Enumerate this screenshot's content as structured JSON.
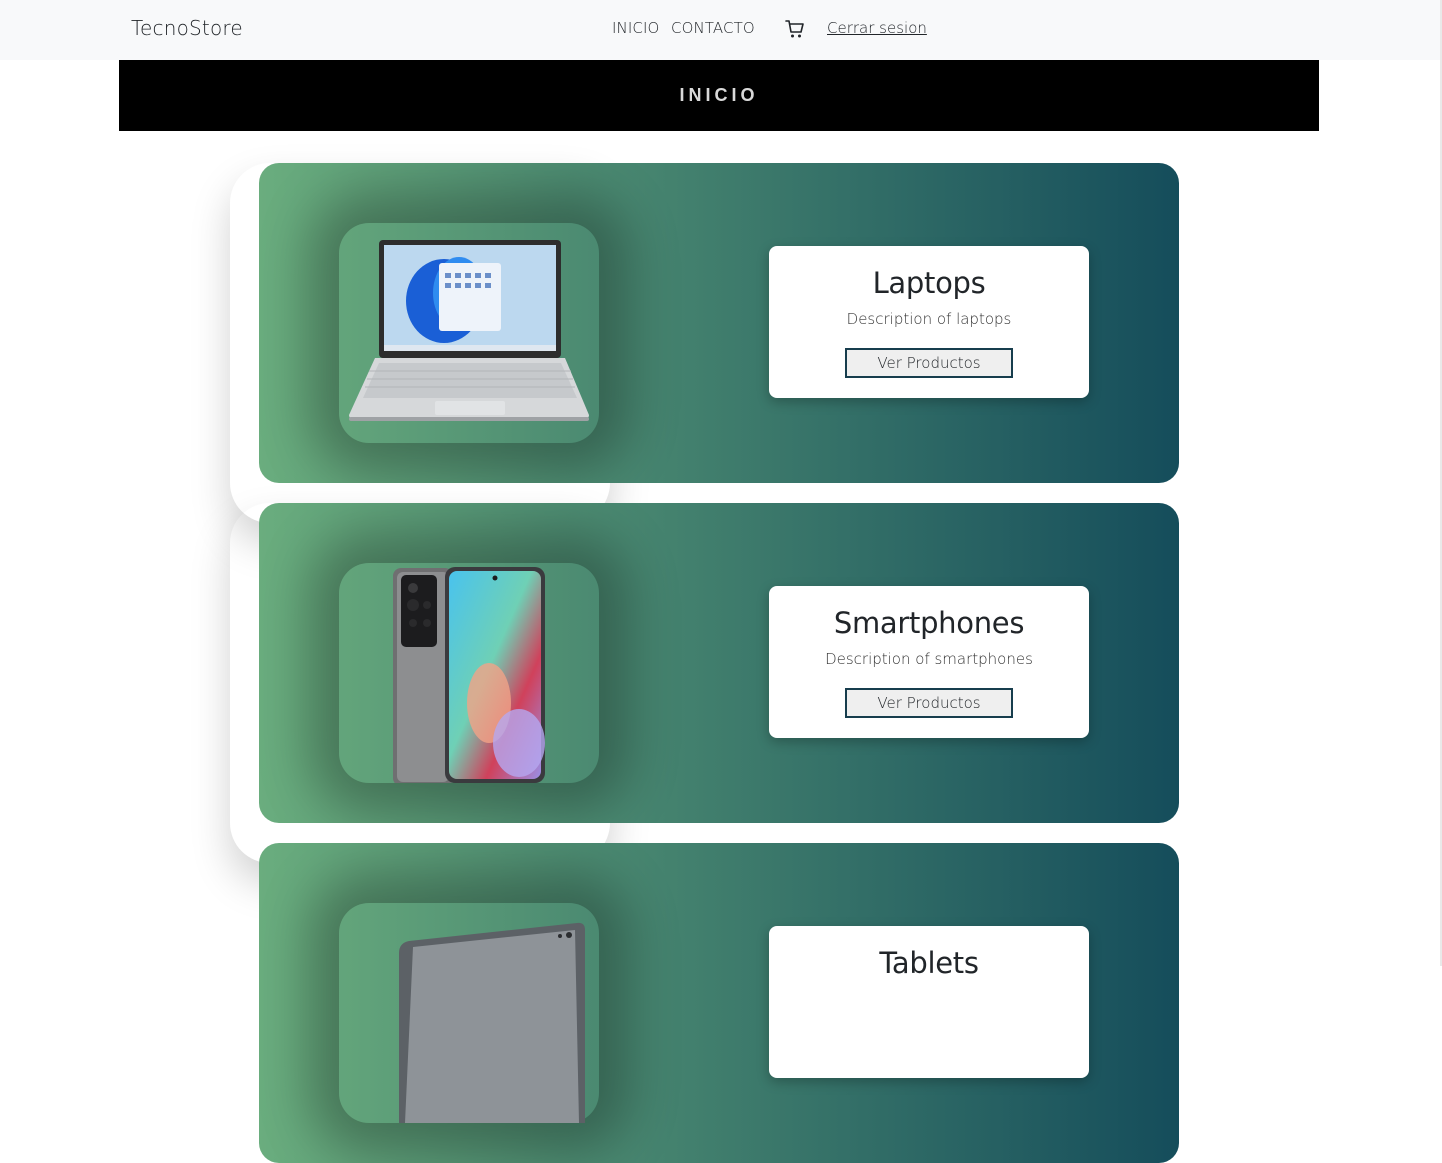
{
  "navbar": {
    "brand": "TecnoStore",
    "links": [
      "INICIO",
      "CONTACTO"
    ],
    "cart_icon": "cart-icon",
    "logout_label": "Cerrar sesion"
  },
  "banner": {
    "title": "INICIO"
  },
  "colors": {
    "gradient_start": "#6aad7e",
    "gradient_end": "#154d5b",
    "button_border": "#173d4d"
  },
  "categories": [
    {
      "title": "Laptops",
      "description": "Description of laptops",
      "button": "Ver Productos",
      "image": "laptop-image"
    },
    {
      "title": "Smartphones",
      "description": "Description of smartphones",
      "button": "Ver Productos",
      "image": "smartphone-image"
    },
    {
      "title": "Tablets",
      "description": "",
      "button": "",
      "image": "tablet-image"
    }
  ]
}
